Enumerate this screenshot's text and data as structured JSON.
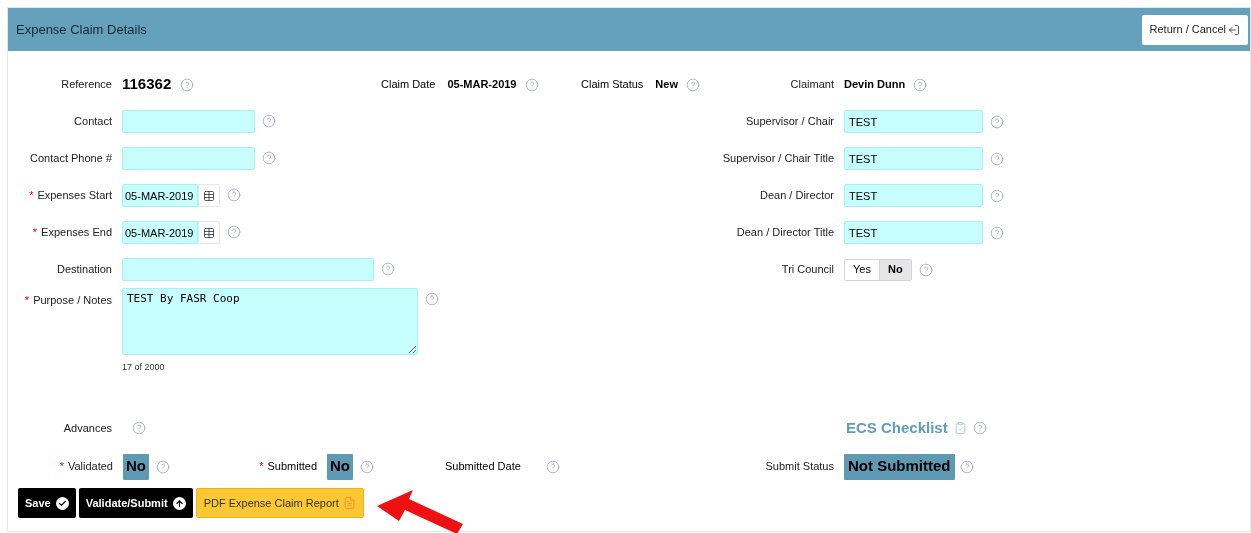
{
  "header": {
    "title": "Expense Claim Details",
    "return_button": "Return / Cancel"
  },
  "summary": [
    {
      "label": "Reference",
      "value": "116362"
    },
    {
      "label": "Claim Date",
      "value": "05-MAR-2019"
    },
    {
      "label": "Claim Status",
      "value": "New"
    }
  ],
  "claimant": {
    "label": "Claimant",
    "value": "Devin Dunn"
  },
  "left_fields": [
    {
      "kind": "text",
      "label": "Contact"
    },
    {
      "kind": "text",
      "label": "Contact Phone #"
    },
    {
      "kind": "date",
      "label": "Expenses Start",
      "required_mark": "*",
      "value": "05-MAR-2019"
    },
    {
      "kind": "date",
      "label": "Expenses End",
      "required_mark": "*",
      "value": "05-MAR-2019"
    },
    {
      "kind": "wide",
      "label": "Destination"
    },
    {
      "kind": "textarea",
      "label": "Purpose / Notes",
      "required_mark": "*",
      "value": "TEST By FASR Coop",
      "counter": "17 of 2000"
    }
  ],
  "right_fields": [
    {
      "kind": "text",
      "label": "Supervisor / Chair",
      "value": "TEST"
    },
    {
      "kind": "text",
      "label": "Supervisor / Chair Title",
      "value": "TEST"
    },
    {
      "kind": "text",
      "label": "Dean / Director",
      "value": "TEST"
    },
    {
      "kind": "text",
      "label": "Dean / Director Title",
      "value": "TEST"
    },
    {
      "kind": "toggle",
      "label": "Tri Council",
      "options": [
        {
          "label": "Yes",
          "selected": false
        },
        {
          "label": "No",
          "selected": true
        }
      ]
    }
  ],
  "advances": {
    "label": "Advances"
  },
  "checklist": {
    "label": "ECS Checklist"
  },
  "statuses": [
    {
      "label": "Validated",
      "required_mark": "*",
      "value": "No"
    },
    {
      "label": "Submitted",
      "required_mark": "*",
      "value": "No"
    },
    {
      "label": "Submitted Date"
    }
  ],
  "submit_status": {
    "label": "Submit Status",
    "value": "Not Submitted"
  },
  "actions": [
    {
      "kind": "save",
      "label": "Save"
    },
    {
      "kind": "submit",
      "label": "Validate/Submit"
    },
    {
      "kind": "pdf",
      "label": "PDF Expense Claim Report"
    }
  ]
}
